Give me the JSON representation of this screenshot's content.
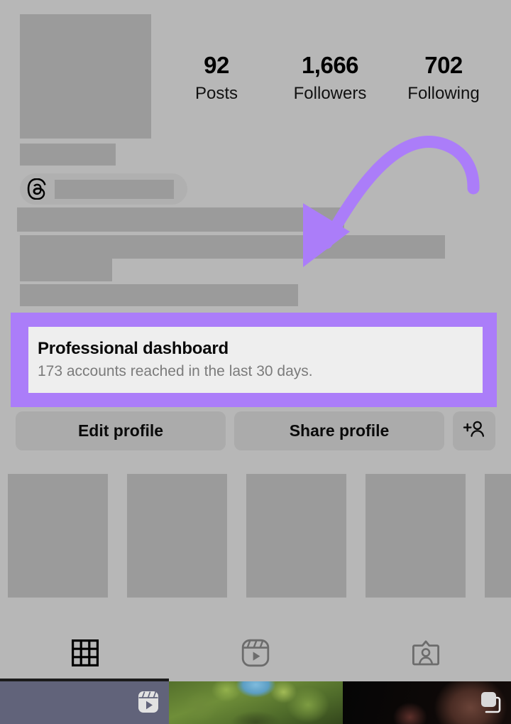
{
  "profile": {
    "avatar_placeholder": "redacted-avatar",
    "username_placeholder": "redacted-username",
    "stats": [
      {
        "value": "92",
        "label": "Posts",
        "name": "posts"
      },
      {
        "value": "1,666",
        "label": "Followers",
        "name": "followers"
      },
      {
        "value": "702",
        "label": "Following",
        "name": "following"
      }
    ],
    "threads_badge": {
      "icon": "threads-icon",
      "handle_placeholder": "redacted-threads-handle"
    },
    "bio_lines": [
      "redacted-bio-line-1",
      "redacted-bio-line-2",
      "redacted-bio-line-3",
      "redacted-bio-line-4"
    ]
  },
  "dashboard": {
    "title": "Professional dashboard",
    "subtitle": "173 accounts reached in the last 30 days.",
    "highlight_color": "#ab7df9",
    "card_background": "#eeeeee",
    "reach_count": "173",
    "period_days": "30"
  },
  "actions": {
    "edit_profile_label": "Edit profile",
    "share_profile_label": "Share profile",
    "add_person_icon": "add-person-icon"
  },
  "annotation": {
    "type": "curved-arrow",
    "color": "#ab7df9",
    "points_to": "Professional dashboard"
  },
  "grid": {
    "thumbnails": [
      "redacted-post-1",
      "redacted-post-2",
      "redacted-post-3",
      "redacted-post-4",
      "redacted-post-5"
    ]
  },
  "tabs": [
    {
      "name": "grid",
      "icon": "grid-icon",
      "active": true
    },
    {
      "name": "reels",
      "icon": "reels-icon",
      "active": false
    },
    {
      "name": "tagged",
      "icon": "tagged-icon",
      "active": false
    }
  ],
  "bottom_strip": [
    {
      "name": "post-preview-1",
      "icon": "reels-icon"
    },
    {
      "name": "post-preview-2",
      "icon": ""
    },
    {
      "name": "post-preview-3",
      "icon": "carousel-icon"
    }
  ],
  "colors": {
    "page_background": "#b7b7b7",
    "redaction": "#9b9b9b",
    "button_background": "#ababab",
    "accent_purple": "#ab7df9",
    "text_primary": "#0a0a0a",
    "text_secondary": "#7b7b7b"
  }
}
